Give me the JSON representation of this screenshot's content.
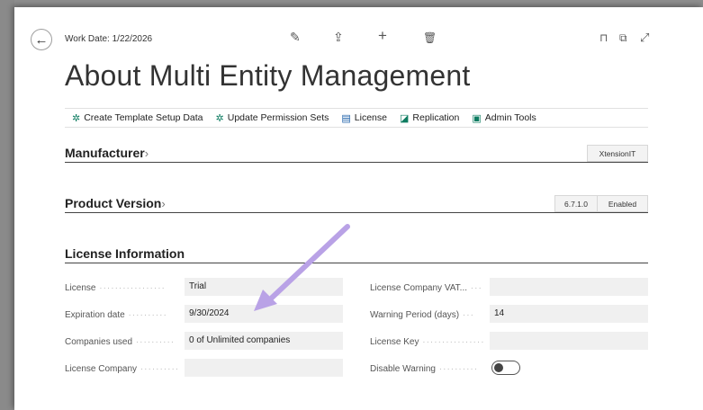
{
  "header": {
    "work_date": "Work Date: 1/22/2026",
    "title": "About Multi Entity Management"
  },
  "toolbar": {
    "items": [
      {
        "label": "Create Template Setup Data",
        "icon": "setup-icon"
      },
      {
        "label": "Update Permission Sets",
        "icon": "setup-icon"
      },
      {
        "label": "License",
        "icon": "license-icon"
      },
      {
        "label": "Replication",
        "icon": "replication-icon"
      },
      {
        "label": "Admin Tools",
        "icon": "admin-tools-icon"
      }
    ]
  },
  "manufacturer": {
    "title": "Manufacturer",
    "chevron": "›",
    "value": "XtensionIT"
  },
  "product_version": {
    "title": "Product Version",
    "chevron": "›",
    "version": "6.7.1.0",
    "status": "Enabled"
  },
  "license_info": {
    "title": "License Information",
    "license_label": "License",
    "license_value": "Trial",
    "expiration_label": "Expiration date",
    "expiration_value": "9/30/2024",
    "companies_label": "Companies used",
    "companies_value": "0 of Unlimited companies",
    "company_label": "License Company",
    "company_value": "",
    "vat_label": "License Company VAT...",
    "vat_value": "",
    "warning_label": "Warning Period (days)",
    "warning_value": "14",
    "key_label": "License Key",
    "key_value": "",
    "disable_label": "Disable Warning"
  },
  "colors": {
    "accent_green": "#0e7c61",
    "annotation_arrow": "#b9a2e6"
  }
}
